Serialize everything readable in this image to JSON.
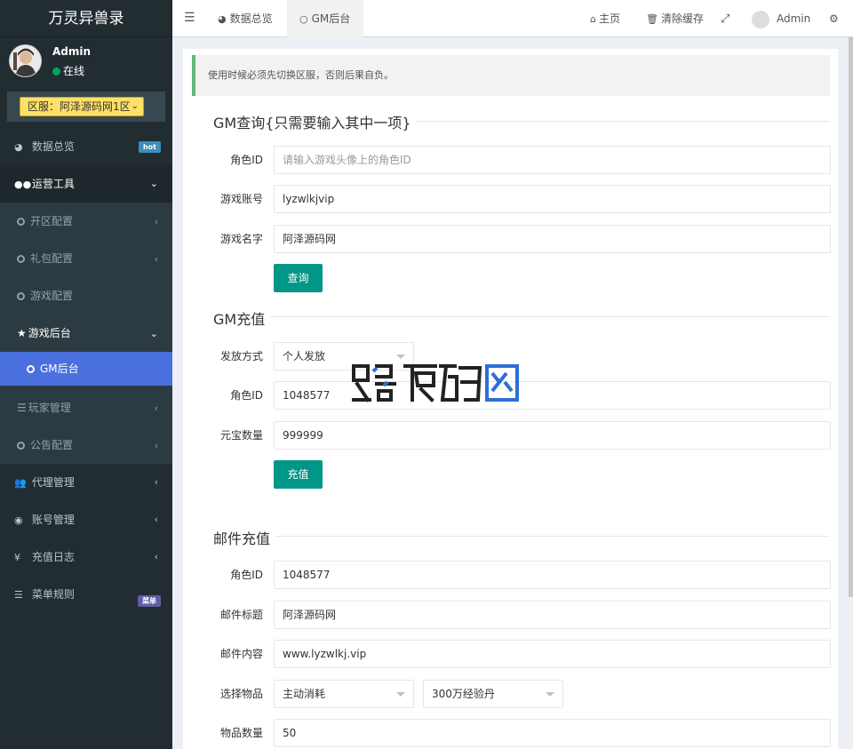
{
  "app": {
    "title": "万灵异兽录"
  },
  "user": {
    "name": "Admin",
    "status": "在线"
  },
  "server": {
    "label": "区服：阿泽源码网1区"
  },
  "sidebar": {
    "dashboard": {
      "label": "数据总览",
      "badge": "hot"
    },
    "ops": {
      "label": "运营工具"
    },
    "ops_children": [
      {
        "label": "开区配置"
      },
      {
        "label": "礼包配置"
      },
      {
        "label": "游戏配置"
      }
    ],
    "game_backend": {
      "label": "游戏后台"
    },
    "gm_backend": {
      "label": "GM后台"
    },
    "player_mgmt": {
      "label": "玩家管理"
    },
    "notice_cfg": {
      "label": "公告配置"
    },
    "agent_mgmt": {
      "label": "代理管理"
    },
    "account_mgmt": {
      "label": "账号管理"
    },
    "recharge_log": {
      "label": "充值日志",
      "icon_text": "¥"
    },
    "menu_rules": {
      "label": "菜单规则",
      "badge": "菜单"
    }
  },
  "topbar": {
    "tabs": [
      {
        "label": "数据总览"
      },
      {
        "label": "GM后台"
      }
    ],
    "home": "主页",
    "clear_cache": "清除缓存",
    "admin": "Admin"
  },
  "alert": {
    "text": "使用时候必须先切换区服，否则后果自负。"
  },
  "gm_query": {
    "title": "GM查询{只需要输入其中一项}",
    "role_id_label": "角色ID",
    "role_id_placeholder": "请输入游戏头像上的角色ID",
    "account_label": "游戏账号",
    "account_value": "lyzwlkjvip",
    "name_label": "游戏名字",
    "name_value": "阿泽源码网",
    "button": "查询"
  },
  "gm_recharge": {
    "title": "GM充值",
    "method_label": "发放方式",
    "method_value": "个人发放",
    "role_id_label": "角色ID",
    "role_id_value": "1048577",
    "amount_label": "元宝数量",
    "amount_value": "999999",
    "button": "充值"
  },
  "mail_recharge": {
    "title": "邮件充值",
    "role_id_label": "角色ID",
    "role_id_value": "1048577",
    "subject_label": "邮件标题",
    "subject_value": "阿泽源码网",
    "body_label": "邮件内容",
    "body_value": "www.lyzwlkj.vip",
    "item_label": "选择物品",
    "item_category": "主动消耗",
    "item_value": "300万经验丹",
    "qty_label": "物品数量",
    "qty_value": "50"
  },
  "colors": {
    "sidebar_bg": "#222d32",
    "active_menu": "#4a70dd",
    "primary_button": "#009688",
    "server_select": "#ffe066",
    "online_dot": "#00a65a"
  }
}
